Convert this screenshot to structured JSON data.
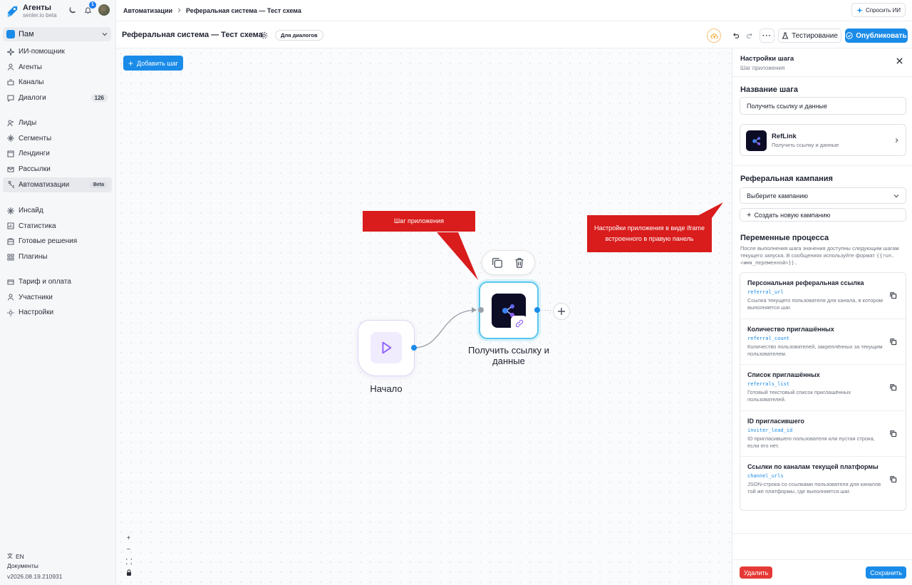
{
  "sidebar": {
    "brand": {
      "name": "Агенты",
      "sub": "senler.io beta"
    },
    "notifications_count": "1",
    "workspace": "Пам",
    "groups": [
      [
        {
          "icon": "sparkle-icon",
          "label": "ИИ-помощник"
        },
        {
          "icon": "agents-icon",
          "label": "Агенты"
        },
        {
          "icon": "channels-icon",
          "label": "Каналы"
        },
        {
          "icon": "dialogs-icon",
          "label": "Диалоги",
          "count": "126"
        }
      ],
      [
        {
          "icon": "leads-icon",
          "label": "Лиды"
        },
        {
          "icon": "segments-icon",
          "label": "Сегменты"
        },
        {
          "icon": "landings-icon",
          "label": "Лендинги"
        },
        {
          "icon": "mailings-icon",
          "label": "Рассылки"
        },
        {
          "icon": "automations-icon",
          "label": "Автоматизации",
          "badge": "Beta",
          "active": true
        }
      ],
      [
        {
          "icon": "insight-icon",
          "label": "Инсайд"
        },
        {
          "icon": "statistics-icon",
          "label": "Статистика"
        },
        {
          "icon": "solutions-icon",
          "label": "Готовые решения"
        },
        {
          "icon": "plugins-icon",
          "label": "Плагины"
        }
      ],
      [
        {
          "icon": "billing-icon",
          "label": "Тариф и оплата"
        },
        {
          "icon": "members-icon",
          "label": "Участники"
        },
        {
          "icon": "settings-icon",
          "label": "Настройки"
        }
      ]
    ],
    "language": "EN",
    "docs": "Документы",
    "version": "v2026.08.19.210931"
  },
  "header": {
    "breadcrumb": [
      "Автоматизации",
      "Реферальная система — Тест схема"
    ],
    "ask_ai": "Спросить ИИ"
  },
  "toolbar": {
    "title": "Реферальная система — Тест схема",
    "tag": "Для диалогов",
    "testing": "Тестирование",
    "publish": "Опубликовать"
  },
  "canvas": {
    "add_step": "Добавить шаг",
    "start_label": "Начало",
    "app_label": "Получить ссылку и данные",
    "callout_app": "Шаг приложения",
    "callout_panel": "Настройки приложения в виде iframe встроенного в правую панель"
  },
  "panel": {
    "title": "Настройки шага",
    "subtitle": "Шаг приложения",
    "step_name_title": "Название шага",
    "step_name_value": "Получить ссылку и данные",
    "app_name": "RefLink",
    "app_desc": "Получить ссылку и данные",
    "campaign_title": "Реферальная кампания",
    "campaign_placeholder": "Выберите кампанию",
    "create_campaign": "Создать новую кампанию",
    "vars_title": "Переменные процесса",
    "vars_desc": "После выполнения шага значения доступны следующим шагам текущего запуска. В сообщениях используйте формат",
    "vars_format": "{{run.<имя_переменной>}}.",
    "variables": [
      {
        "title": "Персональная реферальная ссылка",
        "key": "referral_url",
        "desc": "Ссылка текущего пользователя для канала, в котором выполняется шаг."
      },
      {
        "title": "Количество приглашённых",
        "key": "referral_count",
        "desc": "Количество пользователей, закреплённых за текущим пользователем."
      },
      {
        "title": "Список приглашённых",
        "key": "referrals_list",
        "desc": "Готовый текстовый список приглашённых пользователей."
      },
      {
        "title": "ID пригласившего",
        "key": "inviter_lead_id",
        "desc": "ID пригласившего пользователя или пустая строка, если его нет."
      },
      {
        "title": "Ссылки по каналам текущей платформы",
        "key": "channel_urls",
        "desc": "JSON-строка со ссылками пользователя для каналов той же платформы, где выполняется шаг."
      }
    ],
    "delete": "Удалить",
    "save": "Сохранить"
  },
  "colors": {
    "accent": "#1a8be8",
    "callout": "#d91c1c",
    "danger": "#e53935"
  }
}
